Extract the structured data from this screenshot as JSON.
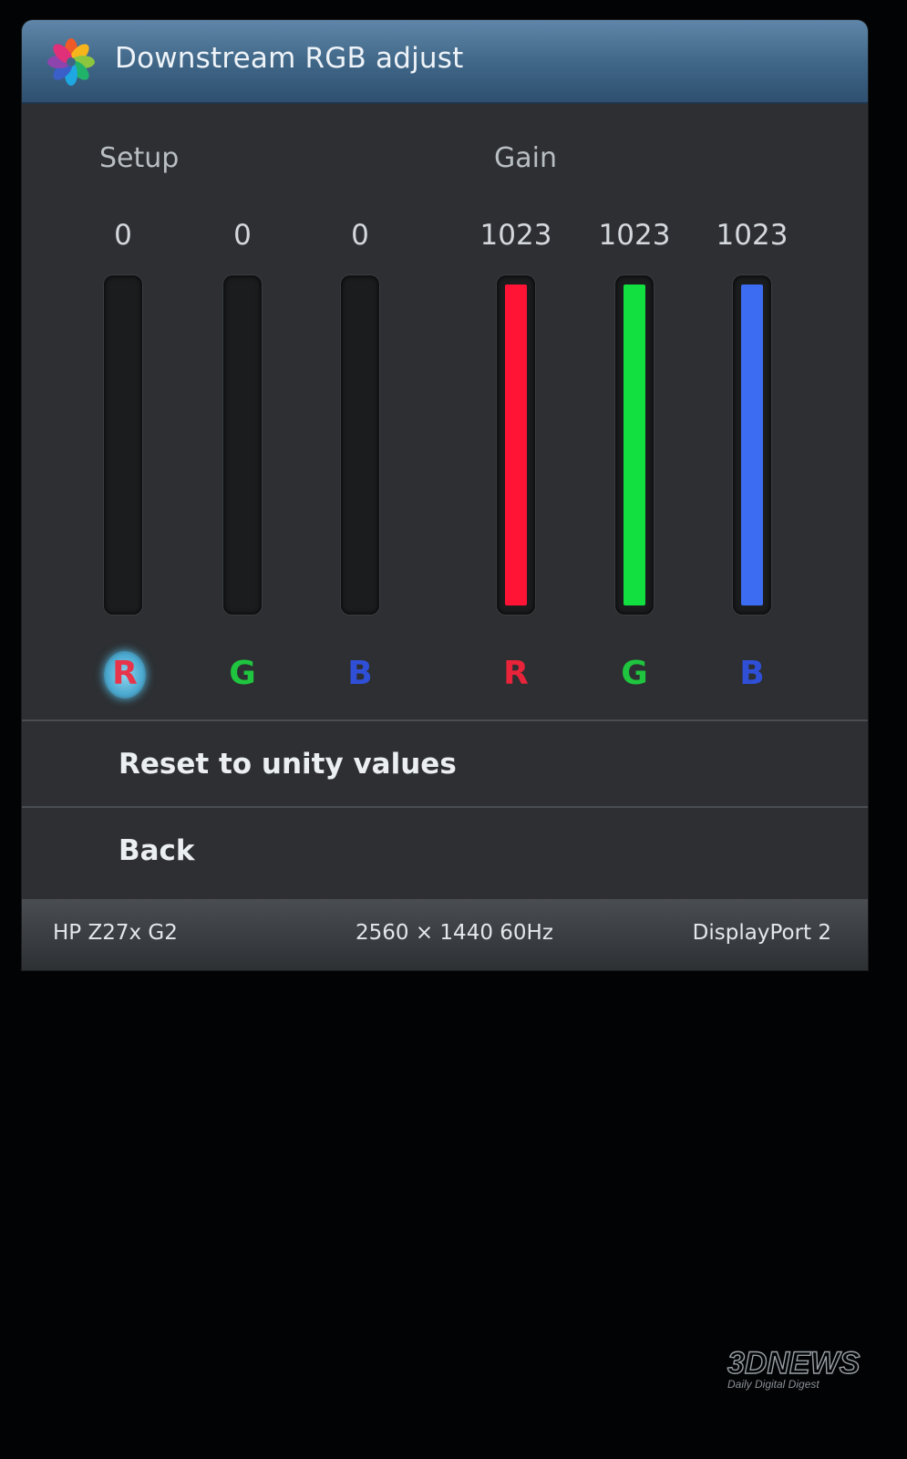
{
  "window": {
    "title": "Downstream RGB adjust",
    "logo_icon": "hp-colorwheel-icon"
  },
  "setup": {
    "label": "Setup",
    "channels": [
      {
        "channel": "R",
        "value": "0",
        "level": 0,
        "color": "#ff2a3d",
        "label_color": "#e8344a",
        "selected": true
      },
      {
        "channel": "G",
        "value": "0",
        "level": 0,
        "color": "#1fe04a",
        "label_color": "#1fc43f",
        "selected": false
      },
      {
        "channel": "B",
        "value": "0",
        "level": 0,
        "color": "#3f6ff0",
        "label_color": "#2f4fd6",
        "selected": false
      }
    ]
  },
  "gain": {
    "label": "Gain",
    "channels": [
      {
        "channel": "R",
        "value": "1023",
        "level": 1,
        "color": "#ff1436",
        "label_color": "#e8243a"
      },
      {
        "channel": "G",
        "value": "1023",
        "level": 1,
        "color": "#12e040",
        "label_color": "#1fc43f"
      },
      {
        "channel": "B",
        "value": "1023",
        "level": 1,
        "color": "#3c6cf2",
        "label_color": "#2f4fd6"
      }
    ]
  },
  "menu": {
    "reset_label": "Reset to unity values",
    "back_label": "Back"
  },
  "status": {
    "model": "HP Z27x G2",
    "resolution": "2560 × 1440  60Hz",
    "input": "DisplayPort 2"
  },
  "watermark": {
    "brand": "3DNEWS",
    "tagline": "Daily Digital Digest"
  }
}
